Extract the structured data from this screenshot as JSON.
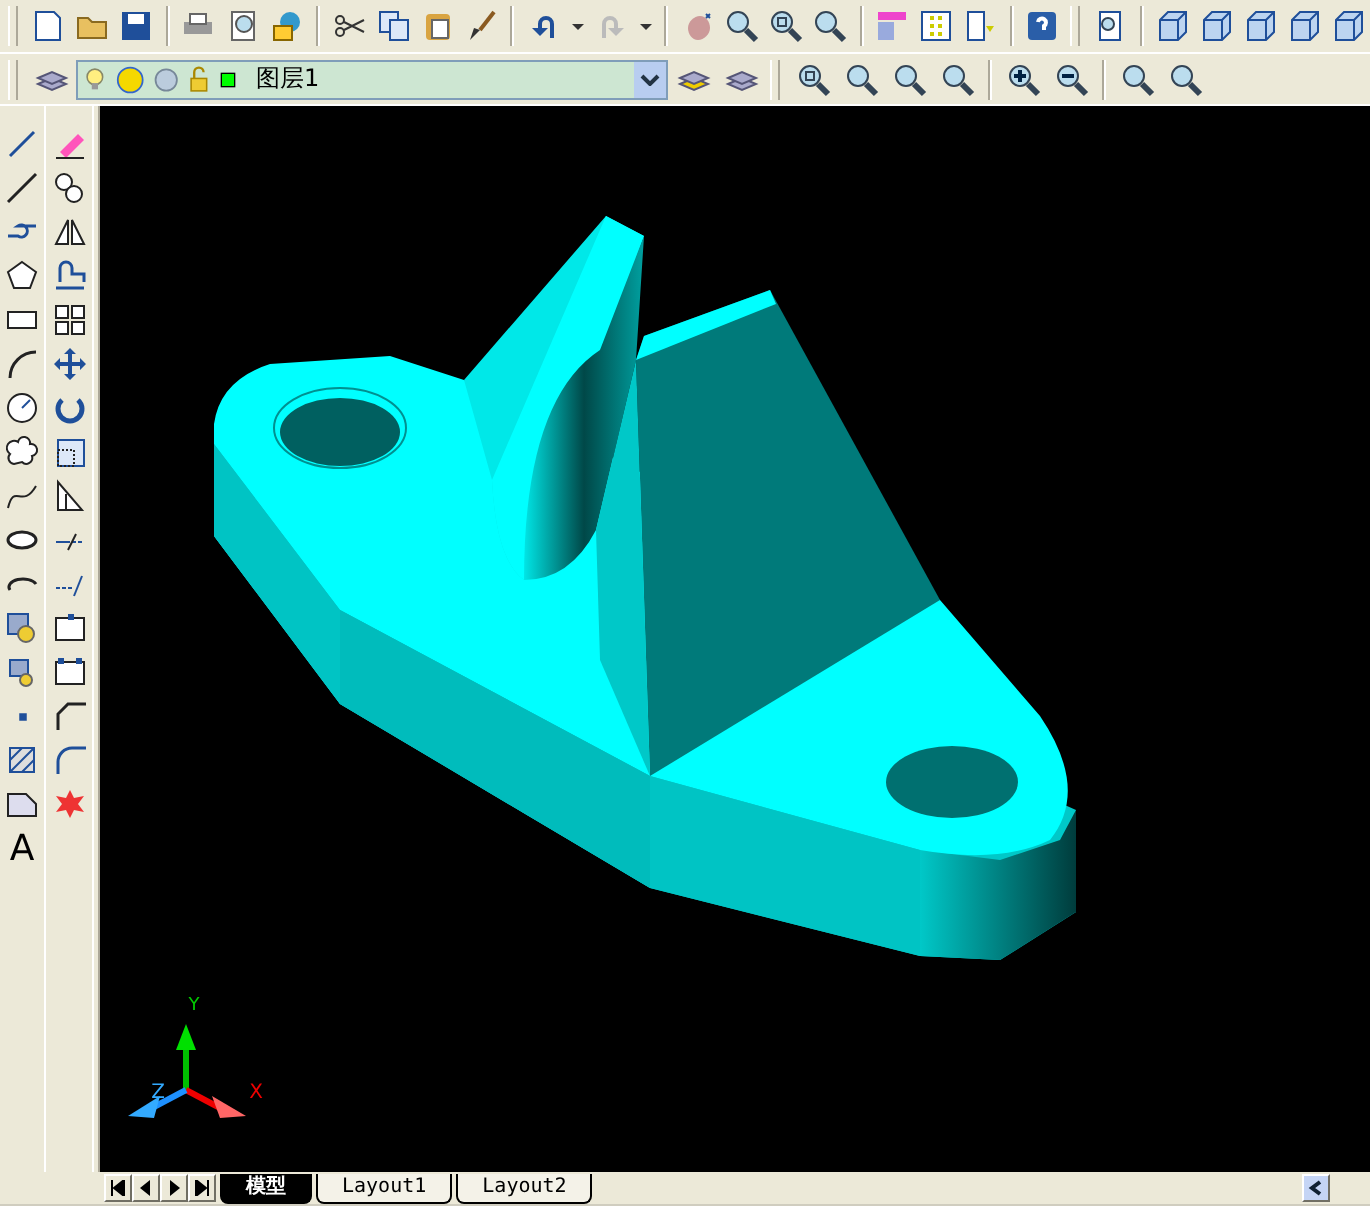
{
  "layer_control": {
    "layer_name": "图层1",
    "on": true,
    "frozen": false,
    "locked": false
  },
  "draw_toolbar": {
    "text_tool": "A"
  },
  "ucs_icon": {
    "x_label": "X",
    "y_label": "Y",
    "z_label": "Z"
  },
  "layout_tabs": [
    {
      "label": "模型",
      "selected": true
    },
    {
      "label": "Layout1",
      "selected": false
    },
    {
      "label": "Layout2",
      "selected": false
    }
  ]
}
